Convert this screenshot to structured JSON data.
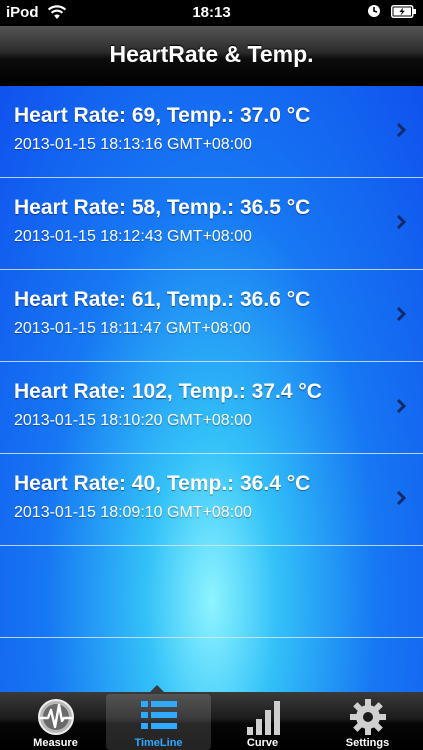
{
  "status_bar": {
    "carrier": "iPod",
    "time": "18:13"
  },
  "nav": {
    "title": "HeartRate & Temp."
  },
  "records": [
    {
      "title": "Heart Rate: 69, Temp.: 37.0 °C",
      "timestamp": "2013-01-15 18:13:16 GMT+08:00"
    },
    {
      "title": "Heart Rate: 58, Temp.: 36.5 °C",
      "timestamp": "2013-01-15 18:12:43 GMT+08:00"
    },
    {
      "title": "Heart Rate: 61, Temp.: 36.6 °C",
      "timestamp": "2013-01-15 18:11:47 GMT+08:00"
    },
    {
      "title": "Heart Rate: 102, Temp.: 37.4 °C",
      "timestamp": "2013-01-15 18:10:20 GMT+08:00"
    },
    {
      "title": "Heart Rate: 40, Temp.: 36.4 °C",
      "timestamp": "2013-01-15 18:09:10 GMT+08:00"
    }
  ],
  "tabs": [
    {
      "label": "Measure",
      "icon": "heartbeat-gauge-icon",
      "selected": false
    },
    {
      "label": "TimeLine",
      "icon": "timeline-list-icon",
      "selected": true
    },
    {
      "label": "Curve",
      "icon": "signal-bars-icon",
      "selected": false
    },
    {
      "label": "Settings",
      "icon": "gear-icon",
      "selected": false
    }
  ],
  "colors": {
    "accent": "#2fa9ff",
    "list_background": "#1665f0"
  }
}
